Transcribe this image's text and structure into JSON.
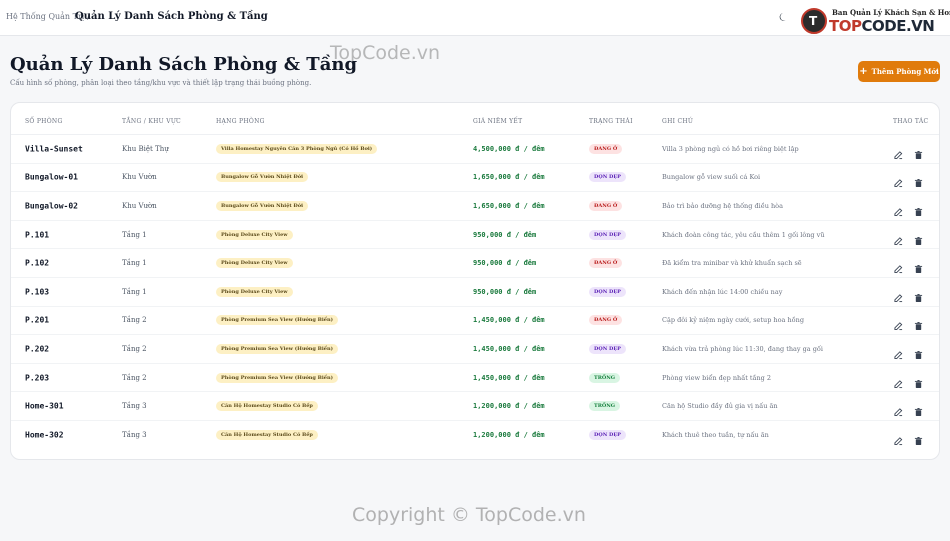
{
  "header": {
    "breadcrumb_root": "Hệ Thống Quản Trị /",
    "breadcrumb_current": "Quản Lý Danh Sách Phòng & Tầng",
    "logo_tagline": "Ban Quản Lý Khách Sạn & Homestay",
    "logo_text_top": "TOP",
    "logo_text_code": "CODE.VN",
    "logo_badge": "T"
  },
  "page": {
    "title": "Quản Lý Danh Sách Phòng & Tầng",
    "subtitle": "Cấu hình số phòng, phân loại theo tầng/khu vực và thiết lập trạng thái buồng phòng.",
    "add_button_label": "Thêm Phòng Mới"
  },
  "watermark": {
    "top": "TopCode.vn",
    "bottom": "Copyright © TopCode.vn"
  },
  "table": {
    "headers": {
      "room": "SỐ PHÒNG",
      "floor": "TẦNG / KHU VỰC",
      "type": "HẠNG PHÒNG",
      "price": "GIÁ NIÊM YẾT",
      "status": "TRẠNG THÁI",
      "note": "GHI CHÚ",
      "actions": "THAO TÁC"
    },
    "rows": [
      {
        "room": "Villa-Sunset",
        "floor": "Khu Biệt Thự",
        "type": "Villa Homestay Nguyên Căn 3 Phòng Ngủ (Có Hồ Bơi)",
        "price": "4,500,000 đ / đêm",
        "status": "ĐANG Ở",
        "status_kind": "busy",
        "note": "Villa 3 phòng ngủ có hồ bơi riêng biệt lập"
      },
      {
        "room": "Bungalow-01",
        "floor": "Khu Vườn",
        "type": "Bungalow Gỗ Vườn Nhiệt Đới",
        "price": "1,650,000 đ / đêm",
        "status": "DỌN DẸP",
        "status_kind": "clean",
        "note": "Bungalow gỗ view suối cá Koi"
      },
      {
        "room": "Bungalow-02",
        "floor": "Khu Vườn",
        "type": "Bungalow Gỗ Vườn Nhiệt Đới",
        "price": "1,650,000 đ / đêm",
        "status": "ĐANG Ở",
        "status_kind": "busy",
        "note": "Bảo trì bảo dưỡng hệ thống điều hòa"
      },
      {
        "room": "P.101",
        "floor": "Tầng 1",
        "type": "Phòng Deluxe City View",
        "price": "950,000 đ / đêm",
        "status": "DỌN DẸP",
        "status_kind": "clean",
        "note": "Khách đoàn công tác, yêu cầu thêm 1 gối lông vũ"
      },
      {
        "room": "P.102",
        "floor": "Tầng 1",
        "type": "Phòng Deluxe City View",
        "price": "950,000 đ / đêm",
        "status": "ĐANG Ở",
        "status_kind": "busy",
        "note": "Đã kiểm tra minibar và khử khuẩn sạch sẽ"
      },
      {
        "room": "P.103",
        "floor": "Tầng 1",
        "type": "Phòng Deluxe City View",
        "price": "950,000 đ / đêm",
        "status": "DỌN DẸP",
        "status_kind": "clean",
        "note": "Khách đến nhận lúc 14:00 chiều nay"
      },
      {
        "room": "P.201",
        "floor": "Tầng 2",
        "type": "Phòng Premium Sea View (Hướng Biển)",
        "price": "1,450,000 đ / đêm",
        "status": "ĐANG Ở",
        "status_kind": "busy",
        "note": "Cặp đôi kỷ niệm ngày cưới, setup hoa hồng"
      },
      {
        "room": "P.202",
        "floor": "Tầng 2",
        "type": "Phòng Premium Sea View (Hướng Biển)",
        "price": "1,450,000 đ / đêm",
        "status": "DỌN DẸP",
        "status_kind": "clean",
        "note": "Khách vừa trả phòng lúc 11:30, đang thay ga gối"
      },
      {
        "room": "P.203",
        "floor": "Tầng 2",
        "type": "Phòng Premium Sea View (Hướng Biển)",
        "price": "1,450,000 đ / đêm",
        "status": "TRỐNG",
        "status_kind": "free",
        "note": "Phòng view biển đẹp nhất tầng 2"
      },
      {
        "room": "Home-301",
        "floor": "Tầng 3",
        "type": "Căn Hộ Homestay Studio Có Bếp",
        "price": "1,200,000 đ / đêm",
        "status": "TRỐNG",
        "status_kind": "free",
        "note": "Căn hộ Studio đầy đủ gia vị nấu ăn"
      },
      {
        "room": "Home-302",
        "floor": "Tầng 3",
        "type": "Căn Hộ Homestay Studio Có Bếp",
        "price": "1,200,000 đ / đêm",
        "status": "DỌN DẸP",
        "status_kind": "clean",
        "note": "Khách thuê theo tuần, tự nấu ăn"
      }
    ]
  },
  "icons": {
    "theme_toggle": "moon-icon",
    "add": "plus-icon",
    "edit": "edit-icon",
    "delete": "trash-icon"
  },
  "colors": {
    "accent": "#e07b0c",
    "price": "#1a7a3d",
    "status_busy": "#b91c1c",
    "status_clean": "#5b21b6",
    "status_free": "#15803d"
  }
}
